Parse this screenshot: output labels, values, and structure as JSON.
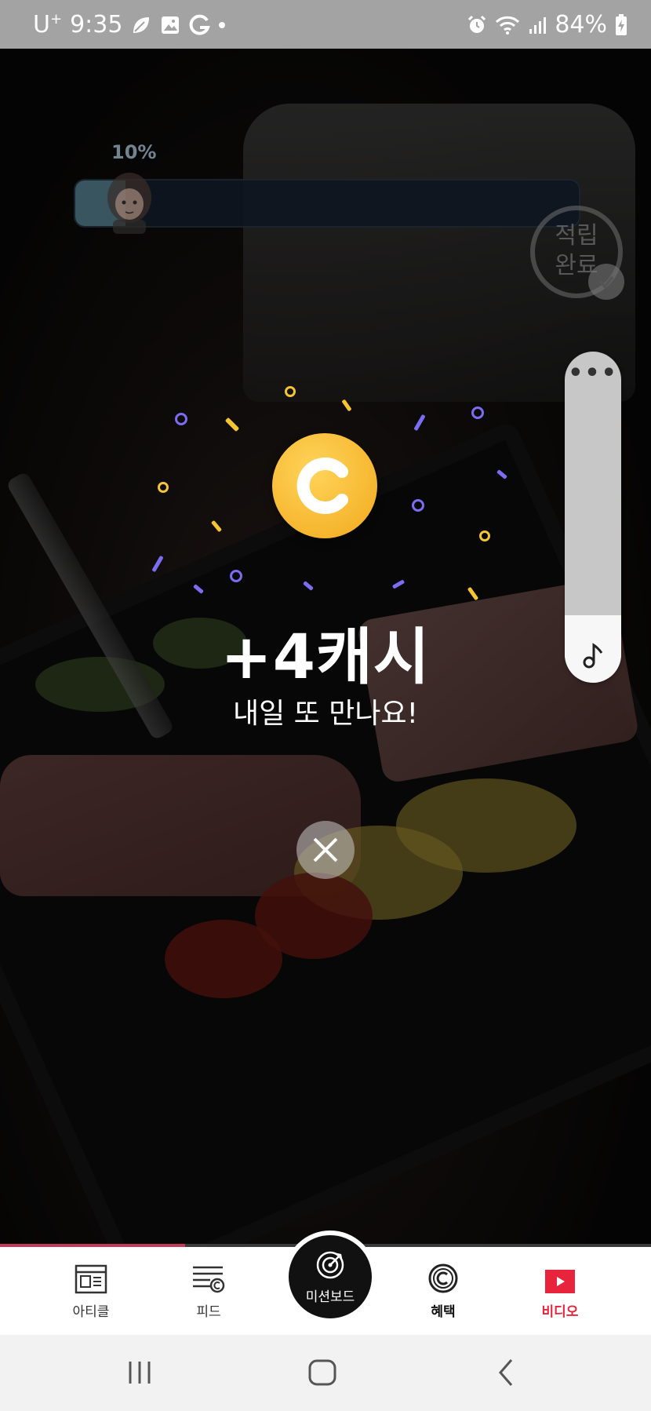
{
  "status_bar": {
    "carrier": "U",
    "carrier_super": "+",
    "time": "9:35",
    "battery": "84%"
  },
  "video": {
    "progress_label": "10%",
    "progress_percent": 10,
    "badge_line1": "적립",
    "badge_line2": "완료"
  },
  "side_panel": {
    "more_label": "•••"
  },
  "reward": {
    "amount": "+4캐시",
    "message": "내일 또 만나요!"
  },
  "bottom_nav": {
    "items": [
      {
        "label": "아티클",
        "icon": "article-icon"
      },
      {
        "label": "피드",
        "icon": "feed-icon"
      },
      {
        "label": "미션보드",
        "icon": "target-icon"
      },
      {
        "label": "혜택",
        "icon": "cash-coin-icon"
      },
      {
        "label": "비디오",
        "icon": "video-play-icon"
      }
    ],
    "active_color": "#e8243c"
  },
  "colors": {
    "coin": "#f2a91c",
    "confetti_purple": "#7b6cf2",
    "confetti_yellow": "#f5c531",
    "progress_bar_accent": "#c23a5a"
  }
}
